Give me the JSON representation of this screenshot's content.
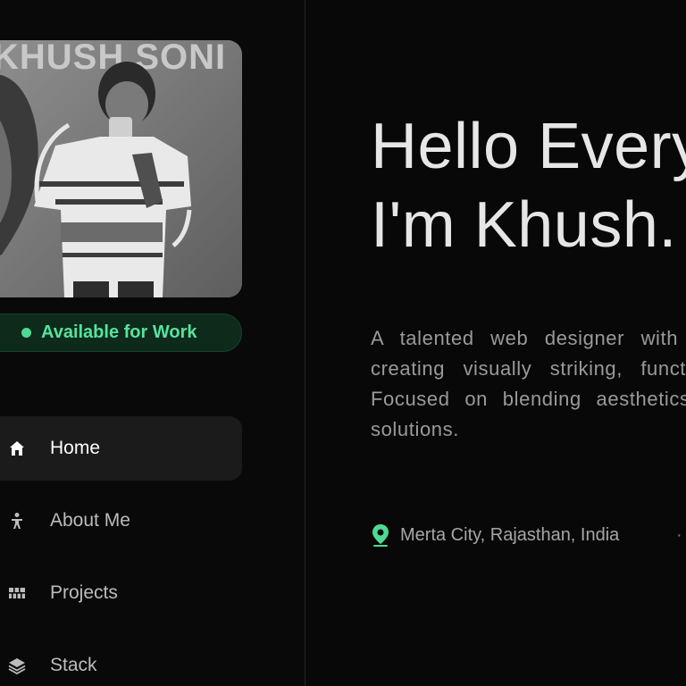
{
  "profile": {
    "photo_caption": "KHUSH SONI"
  },
  "status": {
    "label": "Available for Work",
    "color": "#4ddb93"
  },
  "nav": {
    "items": [
      {
        "label": "Home",
        "icon": "home-icon",
        "active": true
      },
      {
        "label": "About Me",
        "icon": "person-icon",
        "active": false
      },
      {
        "label": "Projects",
        "icon": "grid-icon",
        "active": false
      },
      {
        "label": "Stack",
        "icon": "layers-icon",
        "active": false
      }
    ]
  },
  "hero": {
    "line1": "Hello Every",
    "line2": "I'm Khush."
  },
  "bio": {
    "text": "A talented web designer with a passion for creating visually striking, functional websites. Focused on blending aesthetics with practical solutions."
  },
  "location": {
    "icon": "map-pin-icon",
    "text": "Merta City, Rajasthan, India",
    "separator": "·"
  },
  "colors": {
    "accent": "#4ddb93",
    "background": "#080808",
    "active_nav": "#1b1b1b"
  }
}
